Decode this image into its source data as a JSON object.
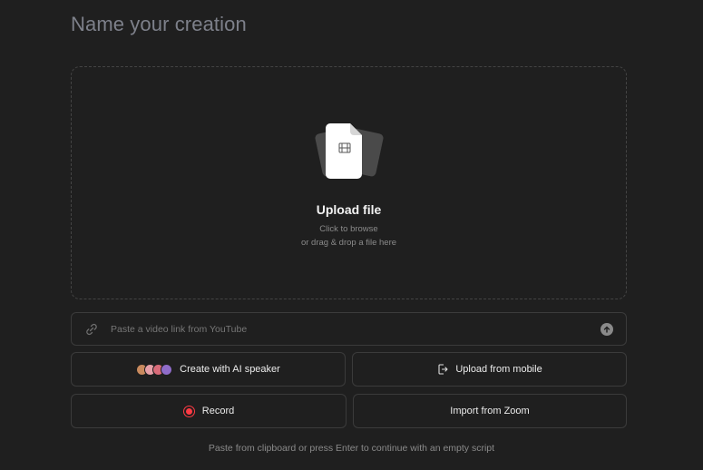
{
  "header": {
    "title_placeholder": "Name your creation"
  },
  "dropzone": {
    "title": "Upload file",
    "subtitle_line1": "Click to browse",
    "subtitle_line2": "or drag & drop a file here"
  },
  "link_bar": {
    "placeholder": "Paste a video link from YouTube"
  },
  "buttons": {
    "ai_speaker": "Create with AI speaker",
    "upload_mobile": "Upload from mobile",
    "record": "Record",
    "import_zoom": "Import from Zoom"
  },
  "footer": {
    "hint": "Paste from clipboard or press Enter to continue with an empty script"
  },
  "colors": {
    "background": "#1f1f1f",
    "record_red": "#ff3b44",
    "border": "#3b3b3b"
  },
  "icons": [
    "film-file-icon",
    "link-icon",
    "arrow-up-icon",
    "avatars-icon",
    "phone-upload-icon",
    "record-icon"
  ]
}
